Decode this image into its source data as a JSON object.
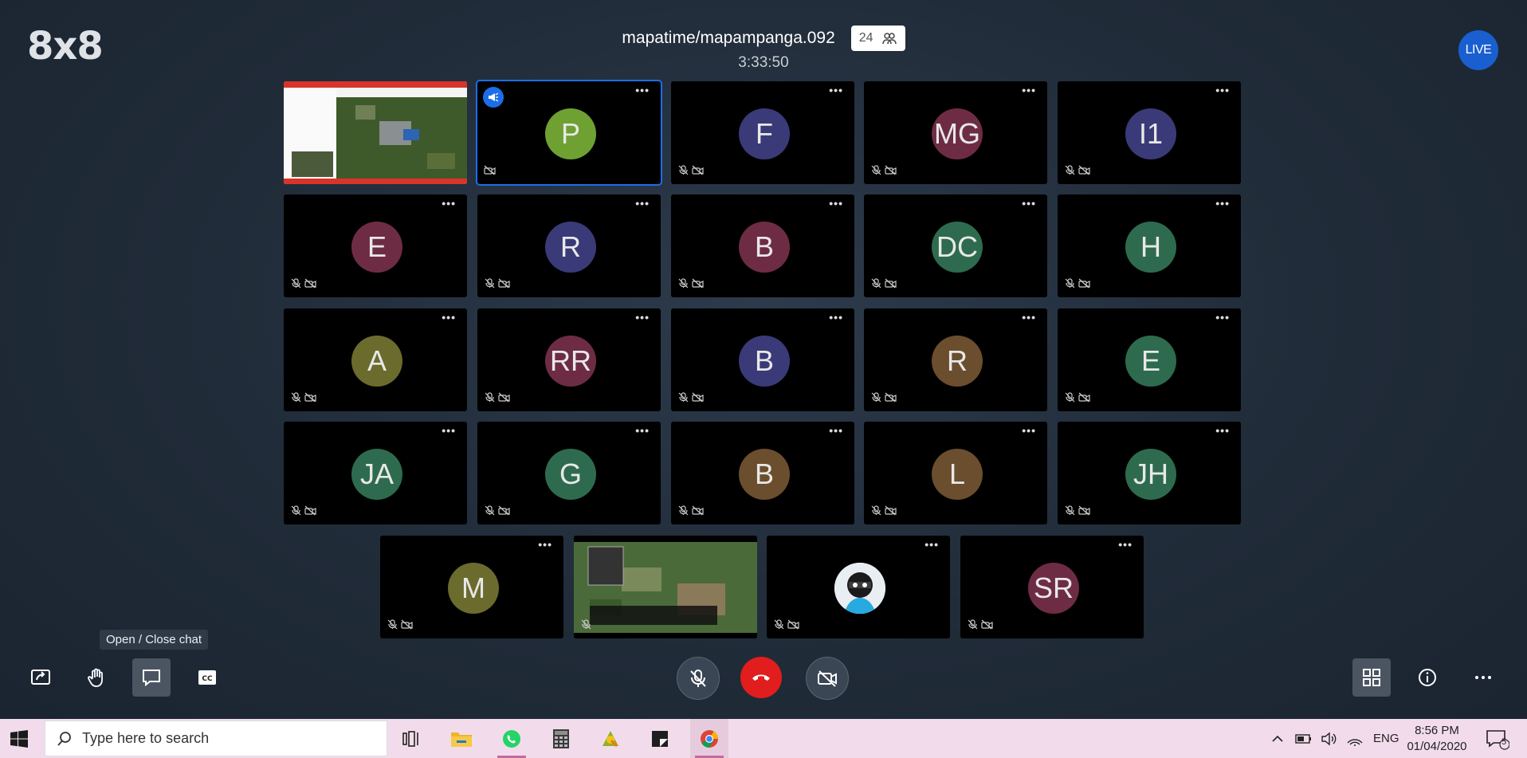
{
  "app": {
    "logo": "8x8",
    "live_label": "LIVE"
  },
  "meeting": {
    "room_name": "mapatime/mapampanga.092",
    "participant_count": "24",
    "elapsed": "3:33:50"
  },
  "tiles": [
    {
      "initials": "",
      "color": "",
      "kind": "screen"
    },
    {
      "initials": "P",
      "color": "#6ea132",
      "kind": "avatar",
      "active": true,
      "speaker": true
    },
    {
      "initials": "F",
      "color": "#3b3a78",
      "kind": "avatar"
    },
    {
      "initials": "MG",
      "color": "#6e2c44",
      "kind": "avatar"
    },
    {
      "initials": "I1",
      "color": "#3b3a78",
      "kind": "avatar"
    },
    {
      "initials": "E",
      "color": "#6e2c44",
      "kind": "avatar"
    },
    {
      "initials": "R",
      "color": "#3b3a78",
      "kind": "avatar"
    },
    {
      "initials": "B",
      "color": "#6e2c44",
      "kind": "avatar"
    },
    {
      "initials": "DC",
      "color": "#2e6b4e",
      "kind": "avatar"
    },
    {
      "initials": "H",
      "color": "#2e6b4e",
      "kind": "avatar"
    },
    {
      "initials": "A",
      "color": "#6b6b2e",
      "kind": "avatar"
    },
    {
      "initials": "RR",
      "color": "#6e2c44",
      "kind": "avatar"
    },
    {
      "initials": "B",
      "color": "#3b3a78",
      "kind": "avatar"
    },
    {
      "initials": "R",
      "color": "#6b4e2e",
      "kind": "avatar"
    },
    {
      "initials": "E",
      "color": "#2e6b4e",
      "kind": "avatar"
    },
    {
      "initials": "JA",
      "color": "#2e6b4e",
      "kind": "avatar"
    },
    {
      "initials": "G",
      "color": "#2e6b4e",
      "kind": "avatar"
    },
    {
      "initials": "B",
      "color": "#6b4e2e",
      "kind": "avatar"
    },
    {
      "initials": "L",
      "color": "#6b4e2e",
      "kind": "avatar"
    },
    {
      "initials": "JH",
      "color": "#2e6b4e",
      "kind": "avatar"
    },
    {
      "initials": "M",
      "color": "#6b6b2e",
      "kind": "avatar"
    },
    {
      "initials": "",
      "color": "",
      "kind": "video-map"
    },
    {
      "initials": "",
      "color": "",
      "kind": "photo"
    },
    {
      "initials": "SR",
      "color": "#6e2c44",
      "kind": "avatar"
    }
  ],
  "toolbar": {
    "tooltip": "Open / Close chat"
  },
  "taskbar": {
    "search_placeholder": "Type here to search",
    "language": "ENG",
    "time": "8:56 PM",
    "date": "01/04/2020",
    "notification_count": "5"
  }
}
